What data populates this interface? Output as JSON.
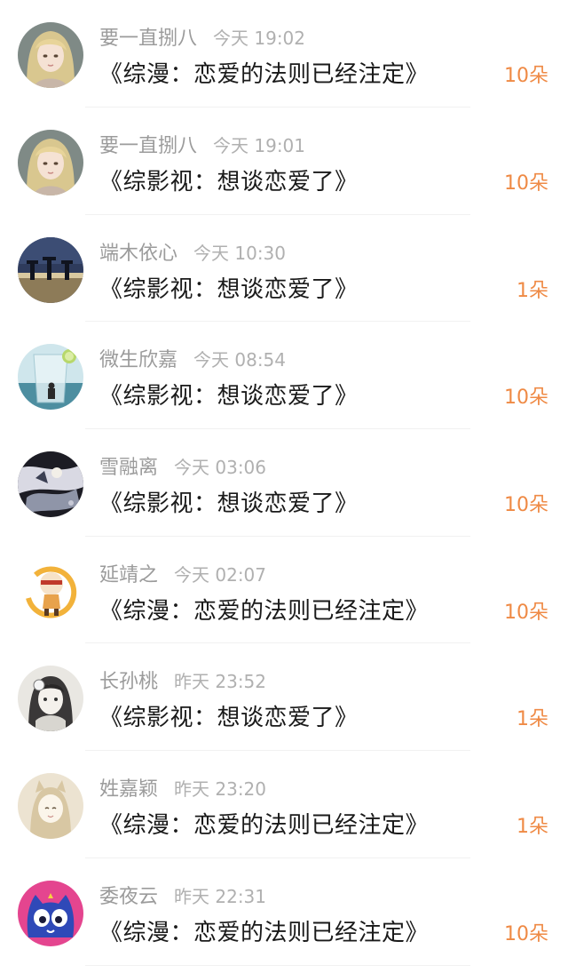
{
  "accent_color": "#ef8a45",
  "items": [
    {
      "user": "要一直捌八",
      "time": "今天 19:02",
      "title": "《综漫：恋爱的法则已经注定》",
      "count": "10朵",
      "avatar_icon": "girl-avatar-icon"
    },
    {
      "user": "要一直捌八",
      "time": "今天 19:01",
      "title": "《综影视：想谈恋爱了》",
      "count": "10朵",
      "avatar_icon": "girl-avatar-icon"
    },
    {
      "user": "端木依心",
      "time": "今天 10:30",
      "title": "《综影视：想谈恋爱了》",
      "count": "1朵",
      "avatar_icon": "silhouette-avatar-icon"
    },
    {
      "user": "微生欣嘉",
      "time": "今天 08:54",
      "title": "《综影视：想谈恋爱了》",
      "count": "10朵",
      "avatar_icon": "glass-avatar-icon"
    },
    {
      "user": "雪融离",
      "time": "今天 03:06",
      "title": "《综影视：想谈恋爱了》",
      "count": "10朵",
      "avatar_icon": "anime-avatar-icon"
    },
    {
      "user": "延靖之",
      "time": "今天 02:07",
      "title": "《综漫：恋爱的法则已经注定》",
      "count": "10朵",
      "avatar_icon": "cartoon-avatar-icon"
    },
    {
      "user": "长孙桃",
      "time": "昨天 23:52",
      "title": "《综影视：想谈恋爱了》",
      "count": "1朵",
      "avatar_icon": "sketch-avatar-icon"
    },
    {
      "user": "姓嘉颖",
      "time": "昨天 23:20",
      "title": "《综漫：恋爱的法则已经注定》",
      "count": "1朵",
      "avatar_icon": "cat-girl-avatar-icon"
    },
    {
      "user": "委夜云",
      "time": "昨天 22:31",
      "title": "《综漫：恋爱的法则已经注定》",
      "count": "10朵",
      "avatar_icon": "blue-cat-avatar-icon"
    }
  ]
}
